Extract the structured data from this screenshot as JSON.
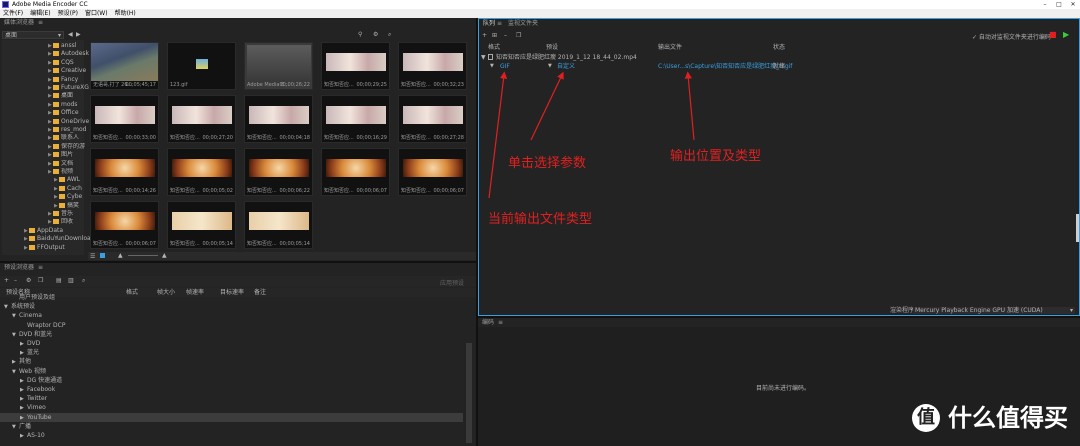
{
  "window": {
    "title": "Adobe Media Encoder CC",
    "minimize": "–",
    "maximize": "□",
    "close": "✕"
  },
  "menu": [
    "文件(F)",
    "编辑(E)",
    "预设(P)",
    "窗口(W)",
    "帮助(H)"
  ],
  "media_browser": {
    "title": "媒体浏览器",
    "location": "桌面",
    "tree": [
      "anssl",
      "Autodesk",
      "CQS",
      "Creative",
      "Fancy",
      "FutureXG",
      "桌面",
      "mods",
      "Office",
      "OneDrive",
      "res_mod",
      "联系人",
      "保存的游",
      "图片",
      "文档",
      "视频",
      "AWL",
      "Cach",
      "Cybe",
      "搞笑",
      "音乐",
      "回收",
      "AppData",
      "BaiduYunDownload",
      "FFOutput"
    ],
    "thumbs": [
      {
        "cap": "无语哥,打了 26...",
        "dur": "00;05;45;17",
        "kind": "game"
      },
      {
        "cap": "123.gif",
        "dur": "",
        "kind": "gif"
      },
      {
        "cap": "Adobe Media E...",
        "dur": "00;00;26;22",
        "kind": "ss"
      },
      {
        "cap": "知否知否应...",
        "dur": "00;00;29;25",
        "kind": "pinkimg"
      },
      {
        "cap": "知否知否应...",
        "dur": "00;00;32;23",
        "kind": "pinkimg"
      },
      {
        "cap": "知否知否应...",
        "dur": "00;00;33;00",
        "kind": "pinkimg"
      },
      {
        "cap": "知否知否应...",
        "dur": "00;00;27;20",
        "kind": "pinkimg"
      },
      {
        "cap": "知否知否应...",
        "dur": "00;00;04;18",
        "kind": "pinkimg"
      },
      {
        "cap": "知否知否应...",
        "dur": "00;00;16;29",
        "kind": "pinkimg"
      },
      {
        "cap": "知否知否应...",
        "dur": "00;00;27;28",
        "kind": "pinkimg"
      },
      {
        "cap": "知否知否应...",
        "dur": "00;00;14;26",
        "kind": "fireimg"
      },
      {
        "cap": "知否知否应...",
        "dur": "00;00;05;02",
        "kind": "fireimg"
      },
      {
        "cap": "知否知否应...",
        "dur": "00;00;06;22",
        "kind": "fireimg"
      },
      {
        "cap": "知否知否应...",
        "dur": "00;00;06;07",
        "kind": "fireimg"
      },
      {
        "cap": "知否知否应...",
        "dur": "00;00;06;07",
        "kind": "fireimg"
      },
      {
        "cap": "知否知否应...",
        "dur": "00;00;06;07",
        "kind": "fireimg"
      },
      {
        "cap": "知否知否应...",
        "dur": "00;00;05;14",
        "kind": "sandimg"
      },
      {
        "cap": "知否知否应...",
        "dur": "00;00;05;14",
        "kind": "sandimg"
      }
    ]
  },
  "preset_browser": {
    "title": "预设浏览器",
    "apply_button": "应用预设",
    "cols": [
      "预设名称",
      "格式",
      "帧大小",
      "帧速率",
      "目标速率",
      "备注"
    ],
    "rows": [
      {
        "label": "用户预设及组",
        "lvl": 1,
        "arrow": ""
      },
      {
        "label": "系统预设",
        "lvl": 0,
        "arrow": "▼"
      },
      {
        "label": "Cinema",
        "lvl": 1,
        "arrow": "▼"
      },
      {
        "label": "Wraptor DCP",
        "lvl": 2,
        "arrow": ""
      },
      {
        "label": "DVD 和蓝光",
        "lvl": 1,
        "arrow": "▼"
      },
      {
        "label": "DVD",
        "lvl": 2,
        "arrow": "▶"
      },
      {
        "label": "蓝光",
        "lvl": 2,
        "arrow": "▶"
      },
      {
        "label": "其他",
        "lvl": 1,
        "arrow": "▶"
      },
      {
        "label": "Web 视频",
        "lvl": 1,
        "arrow": "▼"
      },
      {
        "label": "DG 快速通道",
        "lvl": 2,
        "arrow": "▶"
      },
      {
        "label": "Facebook",
        "lvl": 2,
        "arrow": "▶"
      },
      {
        "label": "Twitter",
        "lvl": 2,
        "arrow": "▶"
      },
      {
        "label": "Vimeo",
        "lvl": 2,
        "arrow": "▶"
      },
      {
        "label": "YouTube",
        "lvl": 2,
        "arrow": "▶"
      },
      {
        "label": "广播",
        "lvl": 1,
        "arrow": "▼"
      },
      {
        "label": "AS-10",
        "lvl": 2,
        "arrow": "▶"
      }
    ]
  },
  "queue": {
    "tab_queue": "队列",
    "tab_watch": "监视文件夹",
    "auto_encode": "✓ 自动对监视文件夹进行编码",
    "cols": [
      "格式",
      "预设",
      "输出文件",
      "状态"
    ],
    "item": {
      "name": "知否知否应是绿肥红瘦 2019_1_12 18_44_02.mp4",
      "format": "GIF",
      "preset": "自定义",
      "output": "C:\\User...s\\Capture\\知否知否应是绿肥红瘦_6.gif",
      "status": "就绪"
    },
    "renderer_label": "渲染程序:",
    "renderer_value": "Mercury Playback Engine GPU 加速 (CUDA)"
  },
  "encoding": {
    "title": "编码",
    "idle": "目前尚未进行编码。"
  },
  "annotations": {
    "a1": "当前输出文件类型",
    "a2": "单击选择参数",
    "a3": "输出位置及类型"
  },
  "watermark": {
    "badge": "值",
    "text": "什么值得买"
  }
}
